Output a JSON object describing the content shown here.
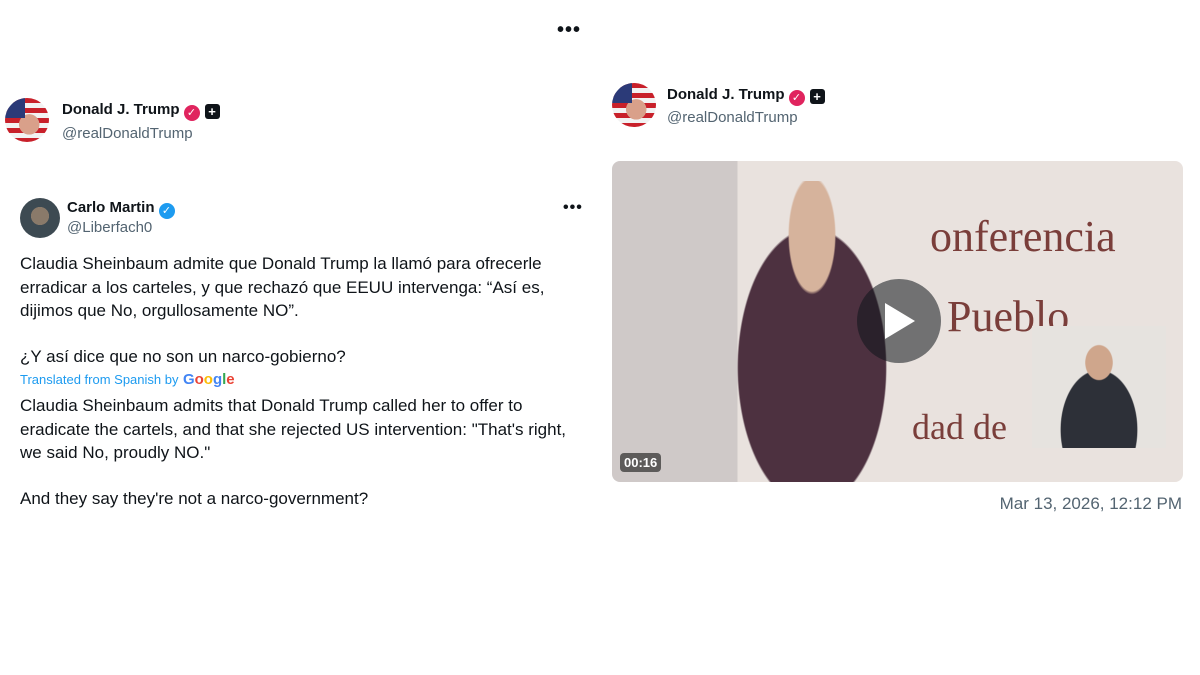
{
  "top_menu": {
    "label": "•••"
  },
  "left": {
    "author": {
      "name": "Donald J. Trump",
      "handle": "@realDonaldTrump"
    },
    "quoted": {
      "author": {
        "name": "Carlo Martin",
        "handle": "@Liberfach0"
      },
      "menu": "•••",
      "original_text": [
        "Claudia Sheinbaum admite que Donald Trump la llamó para ofrecerle",
        "erradicar a los carteles, y que rechazó que EEUU intervenga: “Así es,",
        "dijimos que No, orgullosamente NO”."
      ],
      "original_text_2": "¿Y así dice que no son un narco-gobierno?",
      "translated_label": "Translated from Spanish by",
      "google": [
        "G",
        "o",
        "o",
        "g",
        "l",
        "e"
      ],
      "translation": [
        "Claudia Sheinbaum admits that Donald Trump called her to offer to",
        "eradicate the cartels, and that she rejected US intervention: \"That's right,",
        "we said No, proudly NO.\""
      ],
      "translation_2": "And they say they're not a narco-government?"
    }
  },
  "right": {
    "author": {
      "name": "Donald J. Trump",
      "handle": "@realDonaldTrump"
    },
    "video": {
      "duration": "00:16",
      "banner_text_1": "onferencia",
      "banner_text_2": "Pueblo",
      "banner_text_3": "dad de"
    },
    "timestamp": "Mar 13, 2026, 12:12 PM"
  },
  "colors": {
    "pink_verified": "#e0245e",
    "blue_verified": "#1d9bf0",
    "link": "#1d9bf0",
    "secondary_text": "#536471"
  },
  "icons": {
    "verified_pink": "✓",
    "verified_blue": "✓",
    "plus": "+"
  }
}
